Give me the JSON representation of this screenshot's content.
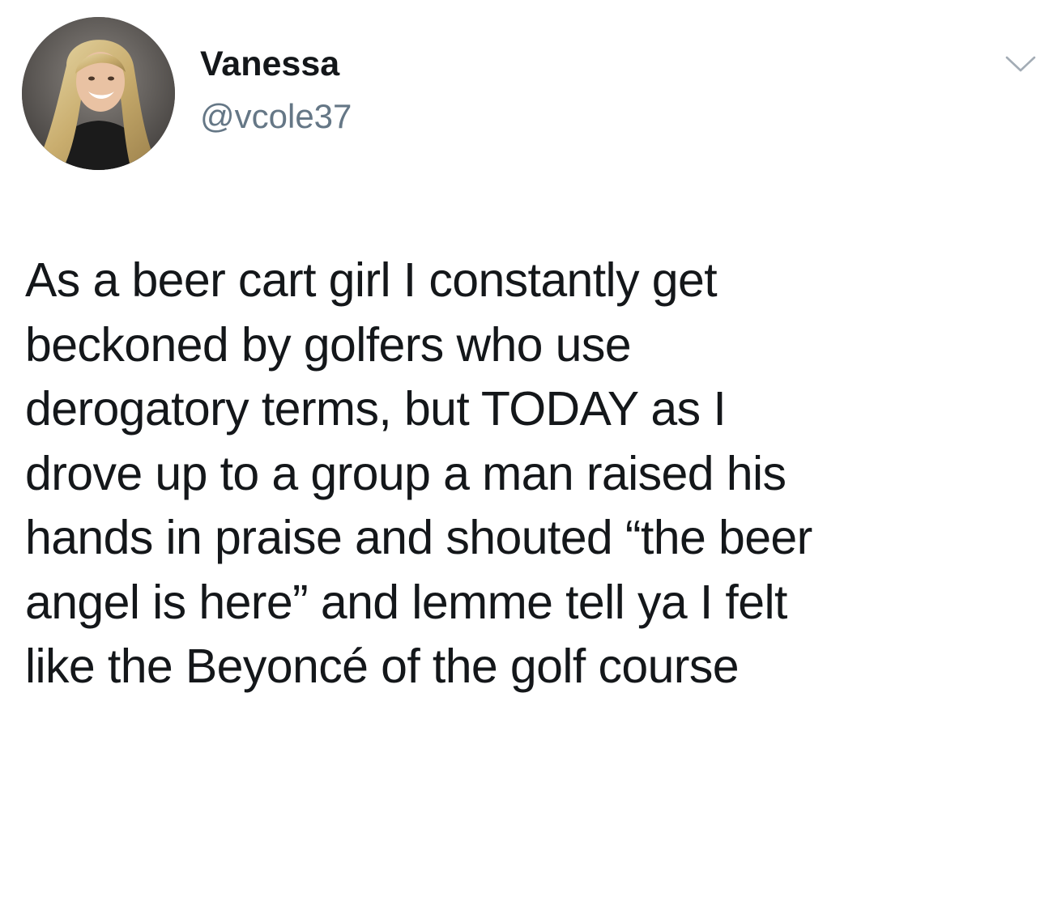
{
  "tweet": {
    "author": {
      "display_name": "Vanessa",
      "handle": "@vcole37",
      "avatar_icon": "profile-photo"
    },
    "menu_icon": "chevron-down-icon",
    "text": "As a beer cart girl I constantly get\nbeckoned by golfers who use\nderogatory terms, but TODAY as I\ndrove up to a group a man raised his\nhands in praise and shouted “the beer\nangel is here” and lemme tell ya I felt\nlike the Beyoncé of the golf course"
  },
  "colors": {
    "text_primary": "#14171a",
    "text_secondary": "#657786",
    "background": "#ffffff"
  }
}
